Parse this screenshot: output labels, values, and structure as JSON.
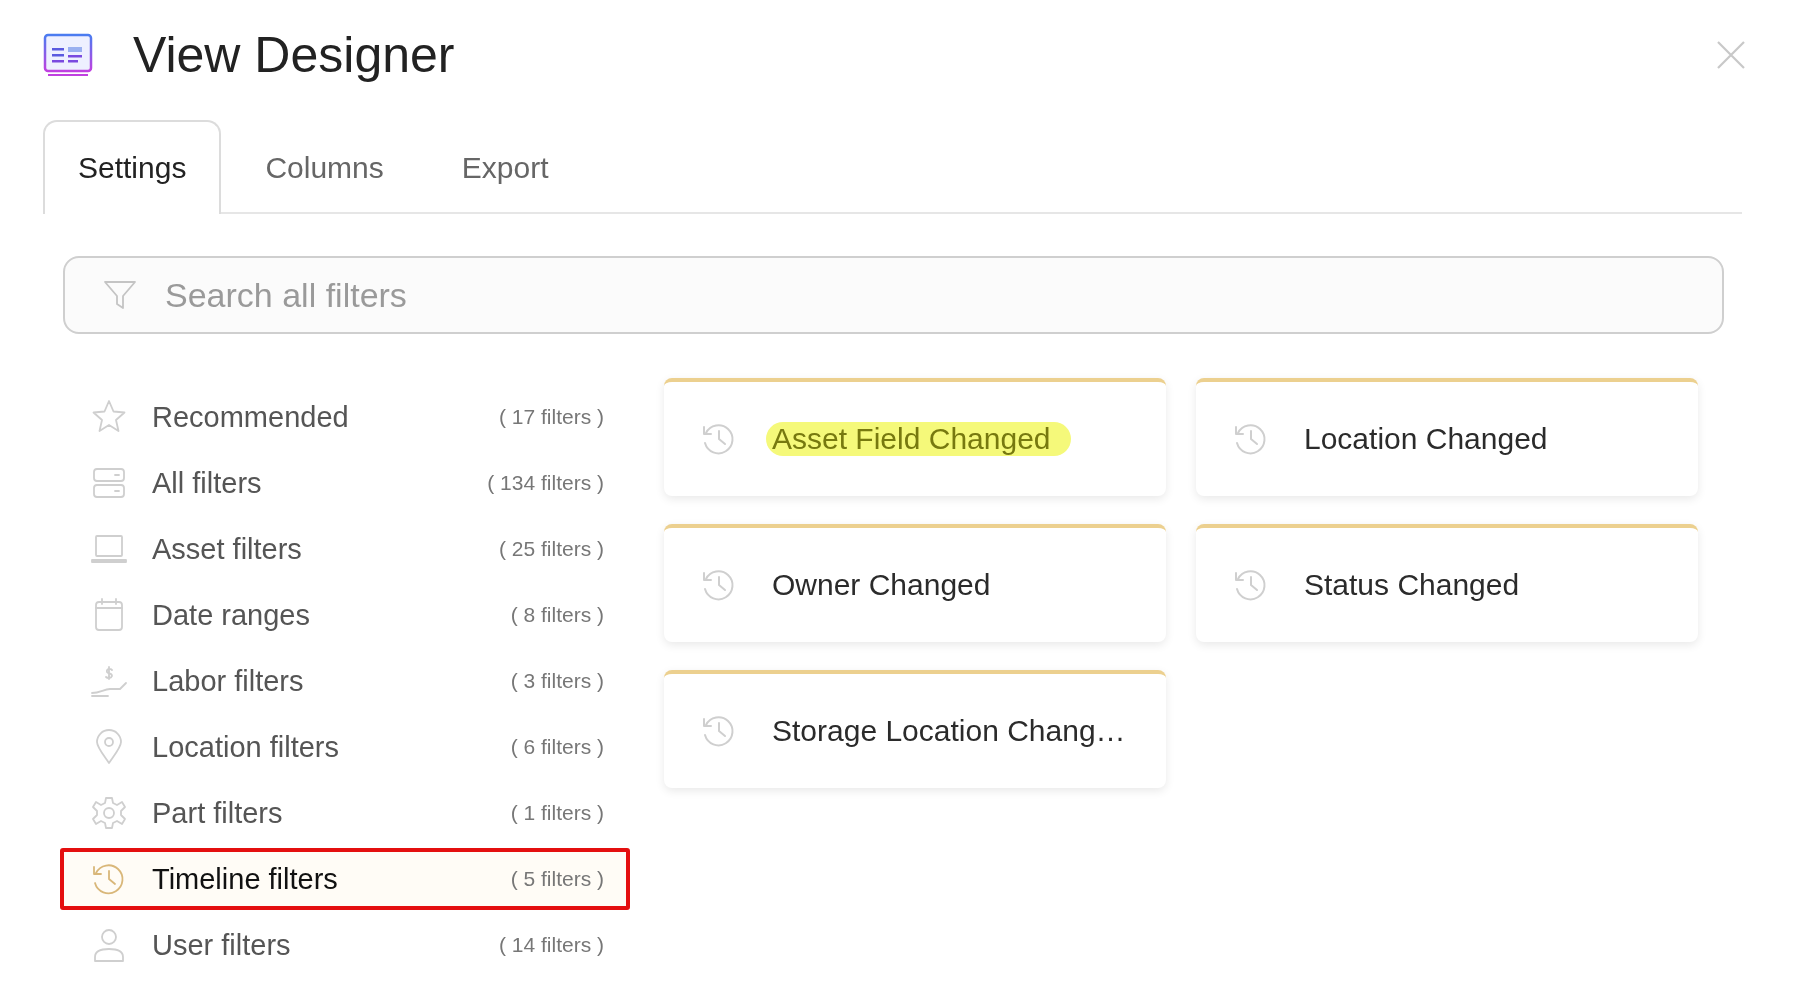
{
  "window": {
    "title": "View Designer"
  },
  "tabs": [
    {
      "label": "Settings",
      "selected": true
    },
    {
      "label": "Columns",
      "selected": false
    },
    {
      "label": "Export",
      "selected": false
    }
  ],
  "search": {
    "placeholder": "Search all filters"
  },
  "categories": [
    {
      "kind": "star",
      "label": "Recommended",
      "count": "( 17 filters )",
      "selected": false
    },
    {
      "kind": "list",
      "label": "All filters",
      "count": "( 134 filters )",
      "selected": false
    },
    {
      "kind": "laptop",
      "label": "Asset filters",
      "count": "( 25 filters )",
      "selected": false
    },
    {
      "kind": "calendar",
      "label": "Date ranges",
      "count": "( 8 filters )",
      "selected": false
    },
    {
      "kind": "labor",
      "label": "Labor filters",
      "count": "( 3 filters )",
      "selected": false
    },
    {
      "kind": "pin",
      "label": "Location filters",
      "count": "( 6 filters )",
      "selected": false
    },
    {
      "kind": "gear",
      "label": "Part filters",
      "count": "( 1 filters )",
      "selected": false
    },
    {
      "kind": "history",
      "label": "Timeline filters",
      "count": "( 5 filters )",
      "selected": true
    },
    {
      "kind": "user",
      "label": "User filters",
      "count": "( 14 filters )",
      "selected": false
    }
  ],
  "filters": [
    {
      "label": "Asset Field Changed",
      "highlighted": true
    },
    {
      "label": "Location Changed",
      "highlighted": false
    },
    {
      "label": "Owner Changed",
      "highlighted": false
    },
    {
      "label": "Status Changed",
      "highlighted": false
    },
    {
      "label": "Storage Location Chang…",
      "highlighted": false
    }
  ]
}
